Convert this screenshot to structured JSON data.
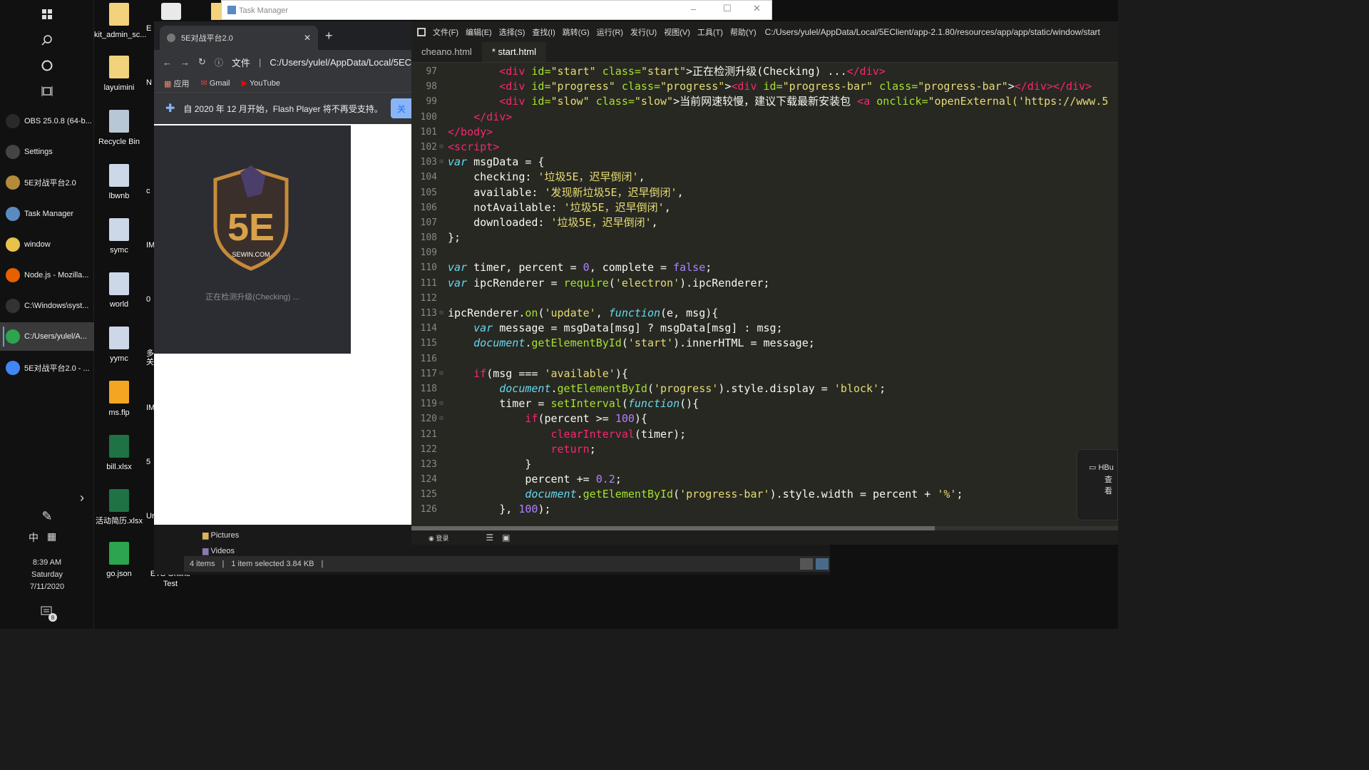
{
  "taskbar": {
    "apps": [
      {
        "label": "OBS 25.0.8 (64-b...",
        "color": "#2a2a2a"
      },
      {
        "label": "Settings",
        "color": "#444"
      },
      {
        "label": "5E对战平台2.0",
        "color": "#b58a3a"
      },
      {
        "label": "Task Manager",
        "color": "#5a8bc0"
      },
      {
        "label": "window",
        "color": "#e8c24a"
      },
      {
        "label": "Node.js - Mozilla...",
        "color": "#e66000"
      },
      {
        "label": "C:\\Windows\\syst...",
        "color": "#333"
      },
      {
        "label": "C:/Users/yulel/A...",
        "color": "#2da44e"
      },
      {
        "label": "5E对战平台2.0 - ...",
        "color": "#4285f4"
      }
    ],
    "ime_lang": "中",
    "ime_mode": "▦",
    "clock": {
      "time": "8:39 AM",
      "day": "Saturday",
      "date": "7/11/2020"
    },
    "notification_count": "8"
  },
  "desktop": {
    "icons": [
      {
        "label": "kit_admin_sc...",
        "color": "#f2d27a"
      },
      {
        "label": "layuimini",
        "color": "#f2d27a"
      },
      {
        "label": "Recycle Bin",
        "color": "#b8c7d6"
      },
      {
        "label": "lbwnb",
        "color": "#ccd7e8"
      },
      {
        "label": "symc",
        "color": "#ccd7e8"
      },
      {
        "label": "world",
        "color": "#ccd7e8"
      },
      {
        "label": "yymc",
        "color": "#ccd7e8"
      },
      {
        "label": "ms.flp",
        "color": "#f4a623"
      },
      {
        "label": "bill.xlsx",
        "color": "#1f7244"
      },
      {
        "label": "活动简历.xlsx",
        "color": "#1f7244"
      },
      {
        "label": "go.json",
        "color": "#2da44e"
      },
      {
        "label": "ETS Online Test",
        "color": "#3a7a3a"
      }
    ],
    "peek_labels": [
      "E",
      "N",
      "c",
      "IM",
      "0",
      "多\n关",
      "IM",
      "5",
      "Ur"
    ]
  },
  "task_manager": {
    "title": "Task Manager"
  },
  "chrome": {
    "tab_title": "5E对战平台2.0",
    "address_scheme": "文件",
    "address": "C:/Users/yulel/AppData/Local/5EC",
    "bookmarks": [
      "应用",
      "Gmail",
      "YouTube"
    ],
    "infobar_text": "自 2020 年 12 月开始，Flash Player 将不再受支持。",
    "infobar_button": "关",
    "app_logo_text": "SEWIN.COM",
    "app_status": "正在检测升级(Checking) ..."
  },
  "explorer": {
    "folders": [
      "Pictures",
      "Videos"
    ],
    "status_items": "4 items",
    "status_selected": "1 item selected  3.84 KB"
  },
  "editor": {
    "menu": [
      "文件(F)",
      "编辑(E)",
      "选择(S)",
      "查找(I)",
      "跳转(G)",
      "运行(R)",
      "发行(U)",
      "视图(V)",
      "工具(T)",
      "帮助(Y)"
    ],
    "path": "C:/Users/yulel/AppData/Local/5EClient/app-2.1.80/resources/app/app/static/window/start",
    "tabs": [
      "cheano.html",
      "* start.html"
    ],
    "status_login": "登录",
    "lines": [
      {
        "n": "97",
        "f": "",
        "segs": [
          [
            "        ",
            ""
          ],
          [
            "<div",
            "tag"
          ],
          [
            " id=",
            "attr"
          ],
          [
            "\"start\"",
            "str"
          ],
          [
            " class=",
            "attr"
          ],
          [
            "\"start\"",
            "str"
          ],
          [
            ">正在检测升级(Checking) ...",
            ""
          ],
          [
            "</div>",
            "tag"
          ]
        ]
      },
      {
        "n": "98",
        "f": "",
        "segs": [
          [
            "        ",
            ""
          ],
          [
            "<div",
            "tag"
          ],
          [
            " id=",
            "attr"
          ],
          [
            "\"progress\"",
            "str"
          ],
          [
            " class=",
            "attr"
          ],
          [
            "\"progress\"",
            "str"
          ],
          [
            ">",
            ""
          ],
          [
            "<div",
            "tag"
          ],
          [
            " id=",
            "attr"
          ],
          [
            "\"progress-bar\"",
            "str"
          ],
          [
            " class=",
            "attr"
          ],
          [
            "\"progress-bar\"",
            "str"
          ],
          [
            ">",
            ""
          ],
          [
            "</div></div>",
            "tag"
          ]
        ]
      },
      {
        "n": "99",
        "f": "",
        "segs": [
          [
            "        ",
            ""
          ],
          [
            "<div",
            "tag"
          ],
          [
            " id=",
            "attr"
          ],
          [
            "\"slow\"",
            "str"
          ],
          [
            " class=",
            "attr"
          ],
          [
            "\"slow\"",
            "str"
          ],
          [
            ">当前网速较慢，建议下载最新安装包 ",
            ""
          ],
          [
            "<a",
            "tag"
          ],
          [
            " onclick=",
            "attr"
          ],
          [
            "\"openExternal('https://www.5",
            "str"
          ]
        ]
      },
      {
        "n": "100",
        "f": "",
        "segs": [
          [
            "    ",
            ""
          ],
          [
            "</div>",
            "tag"
          ]
        ]
      },
      {
        "n": "101",
        "f": "",
        "segs": [
          [
            "</body>",
            "tag"
          ]
        ]
      },
      {
        "n": "102",
        "f": "⊟",
        "segs": [
          [
            "<script>",
            "tag"
          ]
        ]
      },
      {
        "n": "103",
        "f": "⊟",
        "segs": [
          [
            "var",
            "kw"
          ],
          [
            " msgData = {",
            ""
          ]
        ]
      },
      {
        "n": "104",
        "f": "",
        "segs": [
          [
            "    checking: ",
            ""
          ],
          [
            "'垃圾5E，迟早倒闭'",
            "str"
          ],
          [
            ",",
            ""
          ]
        ]
      },
      {
        "n": "105",
        "f": "",
        "segs": [
          [
            "    available: ",
            ""
          ],
          [
            "'发现新垃圾5E，迟早倒闭'",
            "str"
          ],
          [
            ",",
            ""
          ]
        ]
      },
      {
        "n": "106",
        "f": "",
        "segs": [
          [
            "    notAvailable: ",
            ""
          ],
          [
            "'垃圾5E，迟早倒闭'",
            "str"
          ],
          [
            ",",
            ""
          ]
        ]
      },
      {
        "n": "107",
        "f": "",
        "segs": [
          [
            "    downloaded: ",
            ""
          ],
          [
            "'垃圾5E，迟早倒闭'",
            "str"
          ],
          [
            ",",
            ""
          ]
        ]
      },
      {
        "n": "108",
        "f": "",
        "segs": [
          [
            "};",
            ""
          ]
        ]
      },
      {
        "n": "109",
        "f": "",
        "segs": [
          [
            "",
            ""
          ]
        ]
      },
      {
        "n": "110",
        "f": "",
        "segs": [
          [
            "var",
            "kw"
          ],
          [
            " timer, percent = ",
            ""
          ],
          [
            "0",
            "num"
          ],
          [
            ", complete = ",
            ""
          ],
          [
            "false",
            "num"
          ],
          [
            ";",
            ""
          ]
        ]
      },
      {
        "n": "111",
        "f": "",
        "segs": [
          [
            "var",
            "kw"
          ],
          [
            " ipcRenderer = ",
            ""
          ],
          [
            "require",
            "fn"
          ],
          [
            "(",
            ""
          ],
          [
            "'electron'",
            "str"
          ],
          [
            ").ipcRenderer;",
            ""
          ]
        ]
      },
      {
        "n": "112",
        "f": "",
        "segs": [
          [
            "",
            ""
          ]
        ]
      },
      {
        "n": "113",
        "f": "⊟",
        "segs": [
          [
            "ipcRenderer.",
            ""
          ],
          [
            "on",
            "fn"
          ],
          [
            "(",
            ""
          ],
          [
            "'update'",
            "str"
          ],
          [
            ", ",
            ""
          ],
          [
            "function",
            "kw"
          ],
          [
            "(e, msg){",
            ""
          ]
        ]
      },
      {
        "n": "114",
        "f": "",
        "segs": [
          [
            "    ",
            ""
          ],
          [
            "var",
            "kw"
          ],
          [
            " message = msgData[msg] ? msgData[msg] : msg;",
            ""
          ]
        ]
      },
      {
        "n": "115",
        "f": "",
        "segs": [
          [
            "    ",
            ""
          ],
          [
            "document",
            "kw"
          ],
          [
            ".",
            ""
          ],
          [
            "getElementById",
            "fn"
          ],
          [
            "(",
            ""
          ],
          [
            "'start'",
            "str"
          ],
          [
            ").innerHTML = message;",
            ""
          ]
        ]
      },
      {
        "n": "116",
        "f": "",
        "segs": [
          [
            "",
            ""
          ]
        ]
      },
      {
        "n": "117",
        "f": "⊟",
        "segs": [
          [
            "    ",
            ""
          ],
          [
            "if",
            "red"
          ],
          [
            "(msg === ",
            ""
          ],
          [
            "'available'",
            "str"
          ],
          [
            "){",
            ""
          ]
        ]
      },
      {
        "n": "118",
        "f": "",
        "segs": [
          [
            "        ",
            ""
          ],
          [
            "document",
            "kw"
          ],
          [
            ".",
            ""
          ],
          [
            "getElementById",
            "fn"
          ],
          [
            "(",
            ""
          ],
          [
            "'progress'",
            "str"
          ],
          [
            ").style.display = ",
            ""
          ],
          [
            "'block'",
            "str"
          ],
          [
            ";",
            ""
          ]
        ]
      },
      {
        "n": "119",
        "f": "⊟",
        "segs": [
          [
            "        timer = ",
            ""
          ],
          [
            "setInterval",
            "fn"
          ],
          [
            "(",
            ""
          ],
          [
            "function",
            "kw"
          ],
          [
            "(){",
            ""
          ]
        ]
      },
      {
        "n": "120",
        "f": "⊟",
        "segs": [
          [
            "            ",
            ""
          ],
          [
            "if",
            "red"
          ],
          [
            "(percent >= ",
            ""
          ],
          [
            "100",
            "num"
          ],
          [
            "){",
            ""
          ]
        ]
      },
      {
        "n": "121",
        "f": "",
        "segs": [
          [
            "                ",
            ""
          ],
          [
            "clearInterval",
            "red"
          ],
          [
            "(timer);",
            ""
          ]
        ]
      },
      {
        "n": "122",
        "f": "",
        "segs": [
          [
            "                ",
            ""
          ],
          [
            "return",
            "red"
          ],
          [
            ";",
            ""
          ]
        ]
      },
      {
        "n": "123",
        "f": "",
        "segs": [
          [
            "            }",
            ""
          ]
        ]
      },
      {
        "n": "124",
        "f": "",
        "segs": [
          [
            "            percent += ",
            ""
          ],
          [
            "0.2",
            "num"
          ],
          [
            ";",
            ""
          ]
        ]
      },
      {
        "n": "125",
        "f": "",
        "segs": [
          [
            "            ",
            ""
          ],
          [
            "document",
            "kw"
          ],
          [
            ".",
            ""
          ],
          [
            "getElementById",
            "fn"
          ],
          [
            "(",
            ""
          ],
          [
            "'progress-bar'",
            "str"
          ],
          [
            ").style.width = percent + ",
            ""
          ],
          [
            "'%'",
            "str"
          ],
          [
            ";",
            ""
          ]
        ]
      },
      {
        "n": "126",
        "f": "",
        "segs": [
          [
            "        }, ",
            ""
          ],
          [
            "100",
            "num"
          ],
          [
            ");",
            ""
          ]
        ]
      }
    ]
  },
  "notification_peek": {
    "title": "HBu",
    "sub": "查看"
  }
}
